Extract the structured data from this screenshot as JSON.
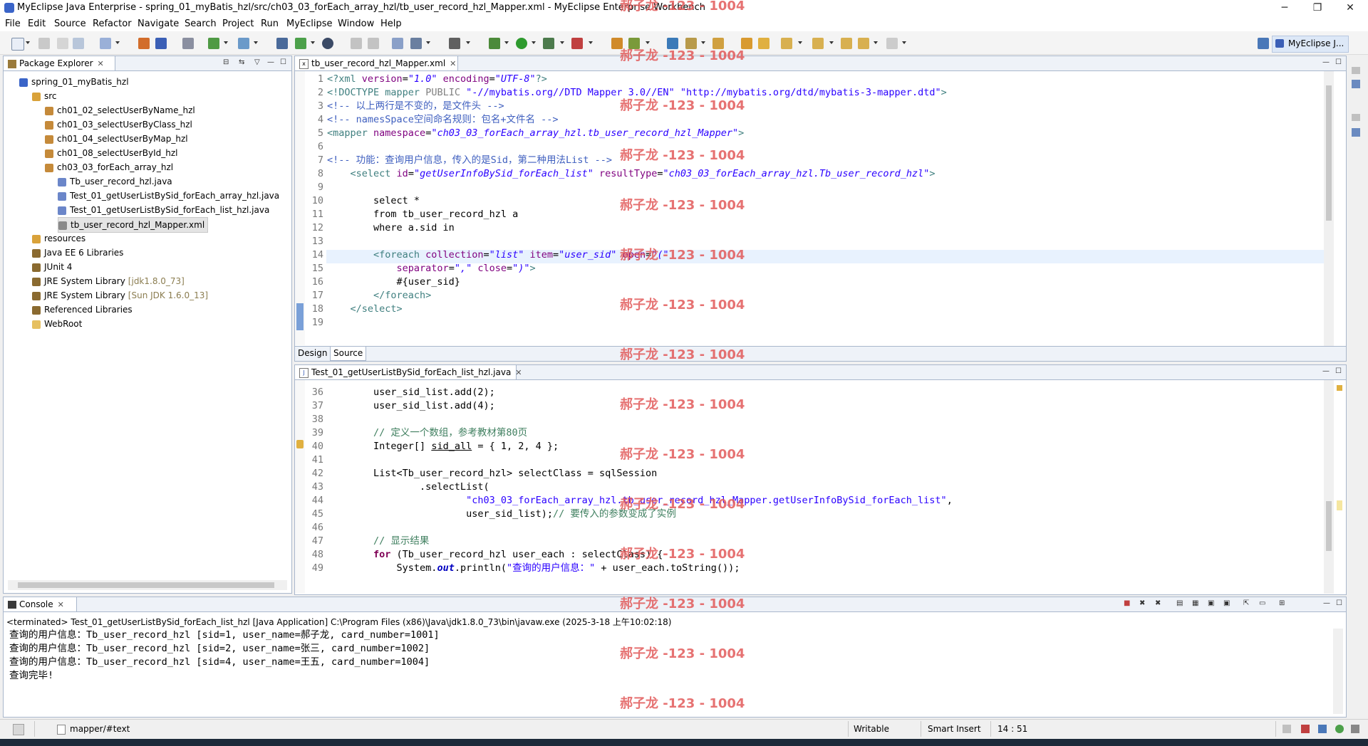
{
  "window": {
    "title": "MyEclipse Java Enterprise - spring_01_myBatis_hzl/src/ch03_03_forEach_array_hzl/tb_user_record_hzl_Mapper.xml - MyEclipse Enterprise Workbench",
    "minimize": "─",
    "maximize": "❐",
    "close": "✕"
  },
  "menu": [
    "File",
    "Edit",
    "Source",
    "Refactor",
    "Navigate",
    "Search",
    "Project",
    "Run",
    "MyEclipse",
    "Window",
    "Help"
  ],
  "perspective": {
    "label": "MyEclipse J..."
  },
  "package_explorer": {
    "title": "Package Explorer",
    "tree": [
      {
        "label": "spring_01_myBatis_hzl",
        "icon": "project-icon",
        "extra": ""
      },
      {
        "label": "src",
        "icon": "source-folder-icon",
        "extra": ""
      },
      {
        "label": "ch01_02_selectUserByName_hzl",
        "icon": "package-icon",
        "extra": ""
      },
      {
        "label": "ch01_03_selectUserByClass_hzl",
        "icon": "package-icon",
        "extra": ""
      },
      {
        "label": "ch01_04_selectUserByMap_hzl",
        "icon": "package-icon",
        "extra": ""
      },
      {
        "label": "ch01_08_selectUserById_hzl",
        "icon": "package-icon",
        "extra": ""
      },
      {
        "label": "ch03_03_forEach_array_hzl",
        "icon": "package-icon",
        "extra": ""
      },
      {
        "label": "Tb_user_record_hzl.java",
        "icon": "java-file-icon",
        "extra": ""
      },
      {
        "label": "Test_01_getUserListBySid_forEach_array_hzl.java",
        "icon": "java-file-icon",
        "extra": ""
      },
      {
        "label": "Test_01_getUserListBySid_forEach_list_hzl.java",
        "icon": "java-file-icon",
        "extra": ""
      },
      {
        "label": "tb_user_record_hzl_Mapper.xml",
        "icon": "xml-file-icon",
        "extra": ""
      },
      {
        "label": "resources",
        "icon": "source-folder-icon",
        "extra": ""
      },
      {
        "label": "Java EE 6 Libraries",
        "icon": "library-icon",
        "extra": ""
      },
      {
        "label": "JUnit 4",
        "icon": "library-icon",
        "extra": ""
      },
      {
        "label": "JRE System Library",
        "icon": "library-icon",
        "extra": "[jdk1.8.0_73]"
      },
      {
        "label": "JRE System Library",
        "icon": "library-icon",
        "extra": "[Sun JDK 1.6.0_13]"
      },
      {
        "label": "Referenced Libraries",
        "icon": "library-icon",
        "extra": ""
      },
      {
        "label": "WebRoot",
        "icon": "folder-icon",
        "extra": ""
      }
    ]
  },
  "xml_editor": {
    "tab": "tb_user_record_hzl_Mapper.xml",
    "design_tab": "Design",
    "source_tab": "Source",
    "line_numbers": [
      "1",
      "2",
      "3",
      "4",
      "5",
      "6",
      "7",
      "8",
      "9",
      "10",
      "11",
      "12",
      "13",
      "14",
      "15",
      "16",
      "17",
      "18",
      "19"
    ],
    "lines": {
      "l1_a": "<?xml ",
      "l1_b": "version",
      "l1_c": "=",
      "l1_d": "\"1.0\"",
      "l1_e": " encoding",
      "l1_f": "=",
      "l1_g": "\"UTF-8\"",
      "l1_h": "?>",
      "l2_a": "<!DOCTYPE ",
      "l2_b": "mapper ",
      "l2_c": "PUBLIC ",
      "l2_d": "\"-//mybatis.org//DTD Mapper 3.0//EN\"",
      "l2_e": " \"http://mybatis.org/dtd/mybatis-3-mapper.dtd\"",
      "l2_f": ">",
      "l3": "<!-- 以上两行是不变的，是文件头 -->",
      "l4": "<!-- namesSpace空间命名规则：包名+文件名 -->",
      "l5_a": "<mapper ",
      "l5_b": "namespace",
      "l5_c": "=",
      "l5_d": "\"ch03_03_forEach_array_hzl.tb_user_record_hzl_Mapper\"",
      "l5_e": ">",
      "l7": "<!-- 功能：查询用户信息，传入的是Sid，第二种用法List -->",
      "l8_a": "    <select ",
      "l8_b": "id",
      "l8_c": "=",
      "l8_d": "\"getUserInfoBySid_forEach_list\"",
      "l8_e": " resultType",
      "l8_f": "=",
      "l8_g": "\"ch03_03_forEach_array_hzl.Tb_user_record_hzl\"",
      "l8_h": ">",
      "l10": "        select *",
      "l11": "        from tb_user_record_hzl a",
      "l12": "        where a.sid in",
      "l14_a": "        <foreach ",
      "l14_b": "collection",
      "l14_c": "=",
      "l14_d": "\"list\"",
      "l14_e": " item",
      "l14_f": "=",
      "l14_g": "\"user_sid\"",
      "l14_h": " open",
      "l14_i": "=",
      "l14_j": "\"(\"",
      "l15_a": "            separator",
      "l15_b": "=",
      "l15_c": "\",\"",
      "l15_d": " close",
      "l15_e": "=",
      "l15_f": "\")\"",
      "l15_g": ">",
      "l16": "            #{user_sid}",
      "l17": "        </foreach>",
      "l18": "    </select>"
    }
  },
  "java_editor": {
    "tab": "Test_01_getUserListBySid_forEach_list_hzl.java",
    "line_numbers": [
      "36",
      "37",
      "38",
      "39",
      "40",
      "41",
      "42",
      "43",
      "44",
      "45",
      "46",
      "47",
      "48",
      "49"
    ],
    "lines": {
      "l36": "        user_sid_list.add(2);",
      "l37": "        user_sid_list.add(4);",
      "l39": "        // 定义一个数组，参考教材第80页",
      "l40_a": "        Integer[] ",
      "l40_b": "sid_all",
      "l40_c": " = { 1, 2, 4 };",
      "l42": "        List<Tb_user_record_hzl> selectClass = sqlSession",
      "l43": "                .selectList(",
      "l44_a": "                        ",
      "l44_b": "\"ch03_03_forEach_array_hzl.tb_user_record_hzl_Mapper.getUserInfoBySid_forEach_list\"",
      "l44_c": ",",
      "l45_a": "                        user_sid_list);",
      "l45_b": "// 要传入的参数变成了实例",
      "l47": "        // 显示结果",
      "l48_a": "        ",
      "l48_b": "for",
      "l48_c": " (Tb_user_record_hzl user_each : selectClass) {",
      "l49_a": "            System.",
      "l49_b": "out",
      "l49_c": ".println(",
      "l49_d": "\"查询的用户信息：\"",
      "l49_e": " + user_each.toString());"
    }
  },
  "console": {
    "title": "Console",
    "header": "<terminated> Test_01_getUserListBySid_forEach_list_hzl [Java Application] C:\\Program Files (x86)\\Java\\jdk1.8.0_73\\bin\\javaw.exe (2025-3-18 上午10:02:18)",
    "lines": [
      "查询的用户信息：Tb_user_record_hzl [sid=1, user_name=郝子龙, card_number=1001]",
      "查询的用户信息：Tb_user_record_hzl [sid=2, user_name=张三, card_number=1002]",
      "查询的用户信息：Tb_user_record_hzl [sid=4, user_name=王五, card_number=1004]",
      "查询完毕!"
    ]
  },
  "status": {
    "breadcrumb": "mapper/#text",
    "writable": "Writable",
    "insert_mode": "Smart Insert",
    "position": "14 : 51"
  },
  "watermark": "郝子龙 -123 - 1004",
  "colors": {
    "keyword": "#7f0055",
    "tag": "#3f7f7f",
    "attribute": "#7f007f",
    "value": "#2a00ff",
    "comment": "#3f5fbf",
    "java_comment": "#3f7f5f",
    "watermark": "#e25a5a"
  }
}
